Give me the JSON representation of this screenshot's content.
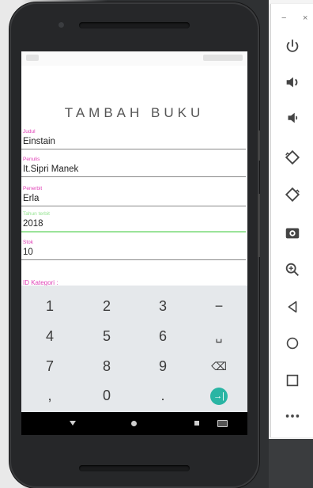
{
  "screen": {
    "title": "TAMBAH BUKU",
    "fields": [
      {
        "label": "Judul",
        "value": "Einstain"
      },
      {
        "label": "Penulis",
        "value": "It.Sipri Manek"
      },
      {
        "label": "Penerbit",
        "value": "Erla"
      },
      {
        "label": "Tahun terbit",
        "value": "2018"
      },
      {
        "label": "Stok",
        "value": "10"
      }
    ],
    "kategori_label": "ID Kategori :"
  },
  "keyboard": {
    "keys": [
      "1",
      "2",
      "3",
      "−",
      "4",
      "5",
      "6",
      "␣",
      "7",
      "8",
      "9",
      "⌫",
      ",",
      "0",
      ".",
      "→|"
    ]
  },
  "emulator": {
    "window_min": "−",
    "window_close": "×",
    "tools": [
      "power-icon",
      "volume-up-icon",
      "volume-down-icon",
      "rotate-left-icon",
      "rotate-right-icon",
      "camera-icon",
      "zoom-icon",
      "back-icon",
      "home-icon",
      "overview-icon",
      "more-icon"
    ]
  }
}
